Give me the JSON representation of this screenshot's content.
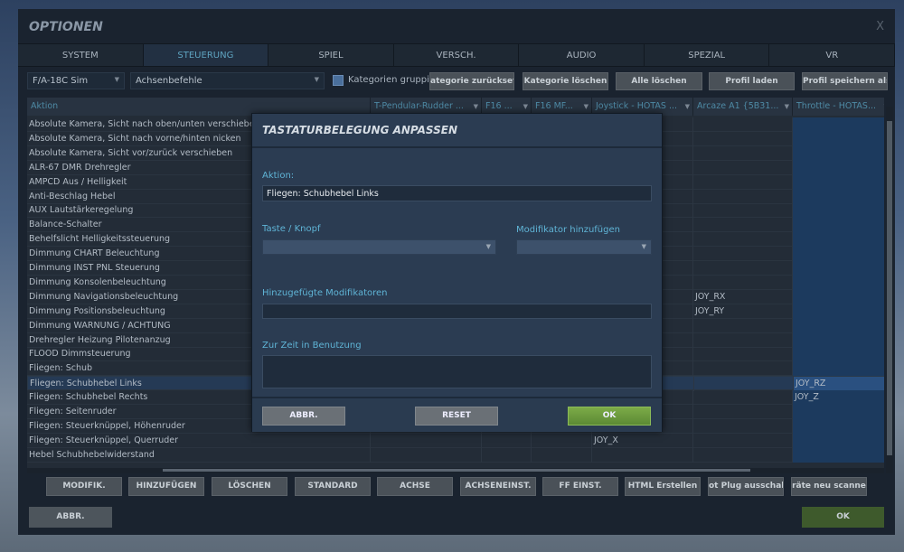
{
  "window": {
    "title": "OPTIONEN",
    "close": "X"
  },
  "tabs": [
    "SYSTEM",
    "STEUERUNG",
    "SPIEL",
    "VERSCH.",
    "AUDIO",
    "SPEZIAL",
    "VR"
  ],
  "toolbar": {
    "aircraft": "F/A-18C Sim",
    "category": "Achsenbefehle",
    "group_label": "Kategorien gruppier",
    "buttons": [
      "ategorie zurücksetz",
      "Kategorie löschen",
      "Alle löschen",
      "Profil laden",
      "Profil speichern als"
    ]
  },
  "table": {
    "columns": [
      "Aktion",
      "T-Pendular-Rudder ...",
      "F16 ...",
      "F16 MF...",
      "Joystick - HOTAS ...",
      "Arcaze A1 {5B31...",
      "Throttle - HOTAS..."
    ],
    "rows": [
      [
        "Absolute Kamera, Sicht nach oben/unten verschieben",
        "",
        "",
        "",
        "",
        "",
        ""
      ],
      [
        "Absolute Kamera, Sicht nach vorne/hinten nicken",
        "",
        "",
        "",
        "",
        "",
        ""
      ],
      [
        "Absolute Kamera, Sicht vor/zurück verschieben",
        "",
        "",
        "",
        "",
        "",
        ""
      ],
      [
        "ALR-67 DMR Drehregler",
        "",
        "",
        "",
        "",
        "",
        ""
      ],
      [
        "AMPCD Aus / Helligkeit",
        "",
        "",
        "",
        "",
        "",
        ""
      ],
      [
        "Anti-Beschlag Hebel",
        "",
        "",
        "",
        "",
        "",
        ""
      ],
      [
        "AUX Lautstärkeregelung",
        "",
        "",
        "",
        "",
        "",
        ""
      ],
      [
        "Balance-Schalter",
        "",
        "",
        "",
        "",
        "",
        ""
      ],
      [
        "Behelfslicht Helligkeitssteuerung",
        "",
        "",
        "",
        "",
        "",
        ""
      ],
      [
        "Dimmung CHART Beleuchtung",
        "",
        "",
        "",
        "",
        "",
        ""
      ],
      [
        "Dimmung INST PNL Steuerung",
        "",
        "",
        "",
        "",
        "",
        ""
      ],
      [
        "Dimmung Konsolenbeleuchtung",
        "",
        "",
        "",
        "",
        "",
        ""
      ],
      [
        "Dimmung Navigationsbeleuchtung",
        "",
        "",
        "",
        "",
        "JOY_RX",
        ""
      ],
      [
        "Dimmung Positionsbeleuchtung",
        "",
        "",
        "",
        "",
        "JOY_RY",
        ""
      ],
      [
        "Dimmung WARNUNG / ACHTUNG",
        "",
        "",
        "",
        "",
        "",
        ""
      ],
      [
        "Drehregler Heizung Pilotenanzug",
        "",
        "",
        "",
        "",
        "",
        ""
      ],
      [
        "FLOOD Dimmsteuerung",
        "",
        "",
        "",
        "",
        "",
        ""
      ],
      [
        "Fliegen: Schub",
        "",
        "",
        "",
        "",
        "",
        ""
      ],
      [
        "Fliegen: Schubhebel Links",
        "",
        "",
        "",
        "",
        "",
        "JOY_RZ"
      ],
      [
        "Fliegen: Schubhebel Rechts",
        "",
        "",
        "",
        "",
        "",
        "JOY_Z"
      ],
      [
        "Fliegen: Seitenruder",
        "",
        "",
        "",
        "",
        "",
        ""
      ],
      [
        "Fliegen: Steuerknüppel, Höhenruder",
        "",
        "",
        "",
        "",
        "",
        ""
      ],
      [
        "Fliegen: Steuerknüppel, Querruder",
        "",
        "",
        "",
        "JOY_X",
        "",
        ""
      ],
      [
        "Hebel Schubhebelwiderstand",
        "",
        "",
        "",
        "",
        "",
        ""
      ]
    ],
    "selected_row": 18
  },
  "bottom_buttons": [
    "MODIFIK.",
    "HINZUFÜGEN",
    "LÖSCHEN",
    "STANDARD",
    "ACHSE",
    "ACHSENEINST.",
    "FF EINST.",
    "HTML Erstellen",
    "ot Plug ausschalte",
    "räte neu scanne"
  ],
  "footer": {
    "cancel": "ABBR.",
    "ok": "OK"
  },
  "modal": {
    "title": "TASTATURBELEGUNG ANPASSEN",
    "action_label": "Aktion:",
    "action_value": "Fliegen: Schubhebel Links",
    "key_label": "Taste / Knopf",
    "modifier_label": "Modifikator hinzufügen",
    "added_label": "Hinzugefügte Modifikatoren",
    "in_use_label": "Zur Zeit in Benutzung",
    "cancel": "ABBR.",
    "reset": "RESET",
    "ok": "OK"
  }
}
